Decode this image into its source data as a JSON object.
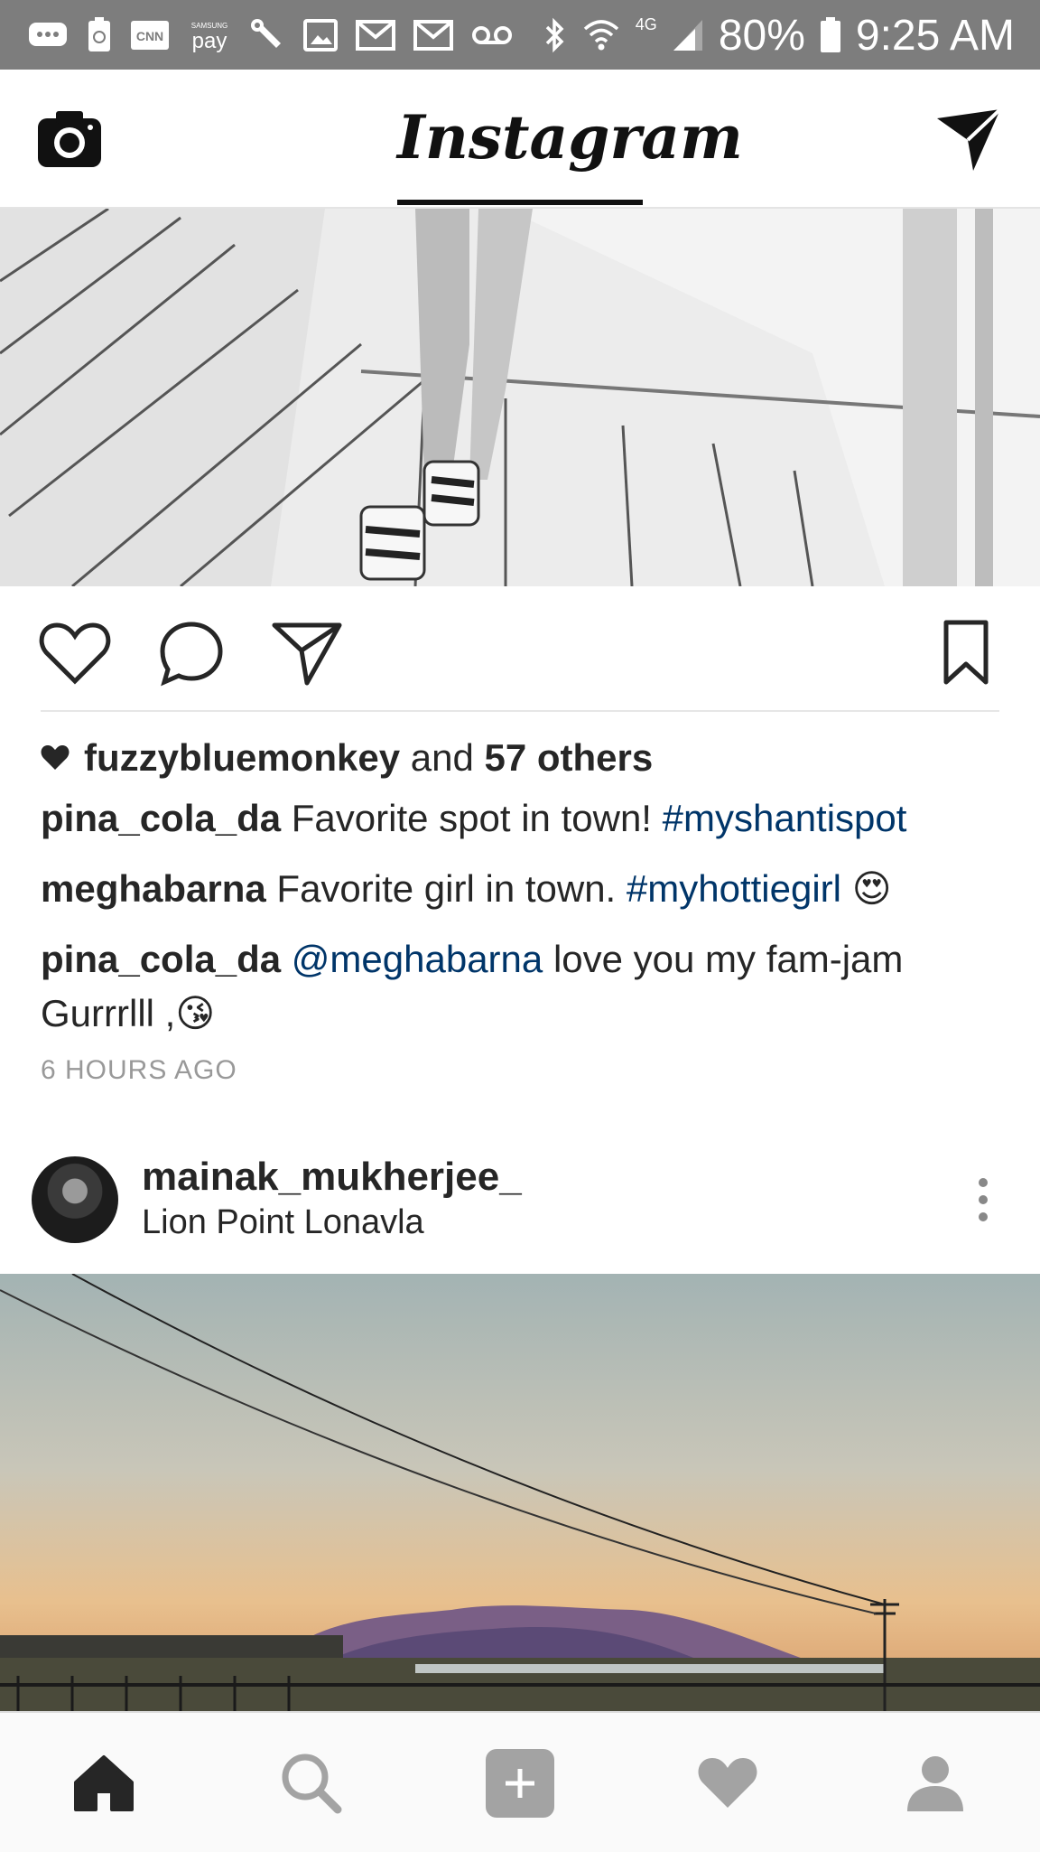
{
  "status_bar": {
    "battery": "80%",
    "time": "9:25 AM",
    "network": "4G",
    "left_icons": [
      "chat-icon",
      "recycle-icon",
      "cnn-icon",
      "samsung-pay-icon",
      "wrench-icon",
      "image-icon",
      "gmail-icon",
      "gmail-icon",
      "voicemail-icon"
    ],
    "cnn_label": "CNN",
    "samsung_label": "SAMSUNG",
    "pay_label": "pay"
  },
  "header": {
    "logo": "Instagram"
  },
  "post1": {
    "likes": {
      "first_user": "fuzzybluemonkey",
      "connector": "and",
      "others": "57 others"
    },
    "caption": {
      "user": "pina_cola_da",
      "text": "Favorite spot in town!",
      "hashtag": "#myshantispot"
    },
    "comments": [
      {
        "user": "meghabarna",
        "text": "Favorite girl in town.",
        "hashtag": "#myhottiegirl",
        "emoji": "😍"
      },
      {
        "user": "pina_cola_da",
        "mention": "@meghabarna",
        "text": "love you my fam-jam Gurrrlll ,",
        "emoji": "😘"
      }
    ],
    "timestamp": "6 HOURS AGO"
  },
  "post2": {
    "username": "mainak_mukherjee_",
    "location": "Lion Point Lonavla"
  },
  "nav": {
    "items": [
      "home-icon",
      "search-icon",
      "add-icon",
      "activity-icon",
      "profile-icon"
    ],
    "active": "home"
  },
  "colors": {
    "status_bar": "#7d7d7d",
    "link_blue": "#003569",
    "text": "#262626",
    "muted": "#999999",
    "nav_inactive": "#a3a3a3"
  }
}
